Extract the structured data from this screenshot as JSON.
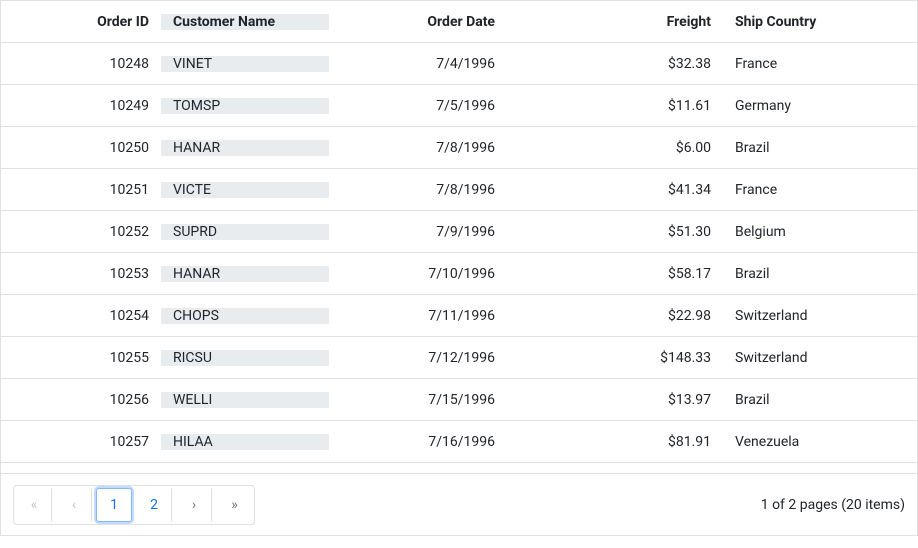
{
  "columns": [
    {
      "label": "Order ID",
      "align": "right",
      "frozen": false
    },
    {
      "label": "Customer Name",
      "align": "left",
      "frozen": true
    },
    {
      "label": "Order Date",
      "align": "right",
      "frozen": false
    },
    {
      "label": "Freight",
      "align": "right",
      "frozen": false
    },
    {
      "label": "Ship Country",
      "align": "left",
      "frozen": false
    }
  ],
  "rows": [
    {
      "orderId": "10248",
      "customer": "VINET",
      "date": "7/4/1996",
      "freight": "$32.38",
      "country": "France"
    },
    {
      "orderId": "10249",
      "customer": "TOMSP",
      "date": "7/5/1996",
      "freight": "$11.61",
      "country": "Germany"
    },
    {
      "orderId": "10250",
      "customer": "HANAR",
      "date": "7/8/1996",
      "freight": "$6.00",
      "country": "Brazil"
    },
    {
      "orderId": "10251",
      "customer": "VICTE",
      "date": "7/8/1996",
      "freight": "$41.34",
      "country": "France"
    },
    {
      "orderId": "10252",
      "customer": "SUPRD",
      "date": "7/9/1996",
      "freight": "$51.30",
      "country": "Belgium"
    },
    {
      "orderId": "10253",
      "customer": "HANAR",
      "date": "7/10/1996",
      "freight": "$58.17",
      "country": "Brazil"
    },
    {
      "orderId": "10254",
      "customer": "CHOPS",
      "date": "7/11/1996",
      "freight": "$22.98",
      "country": "Switzerland"
    },
    {
      "orderId": "10255",
      "customer": "RICSU",
      "date": "7/12/1996",
      "freight": "$148.33",
      "country": "Switzerland"
    },
    {
      "orderId": "10256",
      "customer": "WELLI",
      "date": "7/15/1996",
      "freight": "$13.97",
      "country": "Brazil"
    },
    {
      "orderId": "10257",
      "customer": "HILAA",
      "date": "7/16/1996",
      "freight": "$81.91",
      "country": "Venezuela"
    }
  ],
  "pager": {
    "first_icon": "«",
    "prev_icon": "‹",
    "next_icon": "›",
    "last_icon": "»",
    "pages": [
      "1",
      "2"
    ],
    "active_page": "1",
    "info": "1 of 2 pages (20 items)"
  }
}
